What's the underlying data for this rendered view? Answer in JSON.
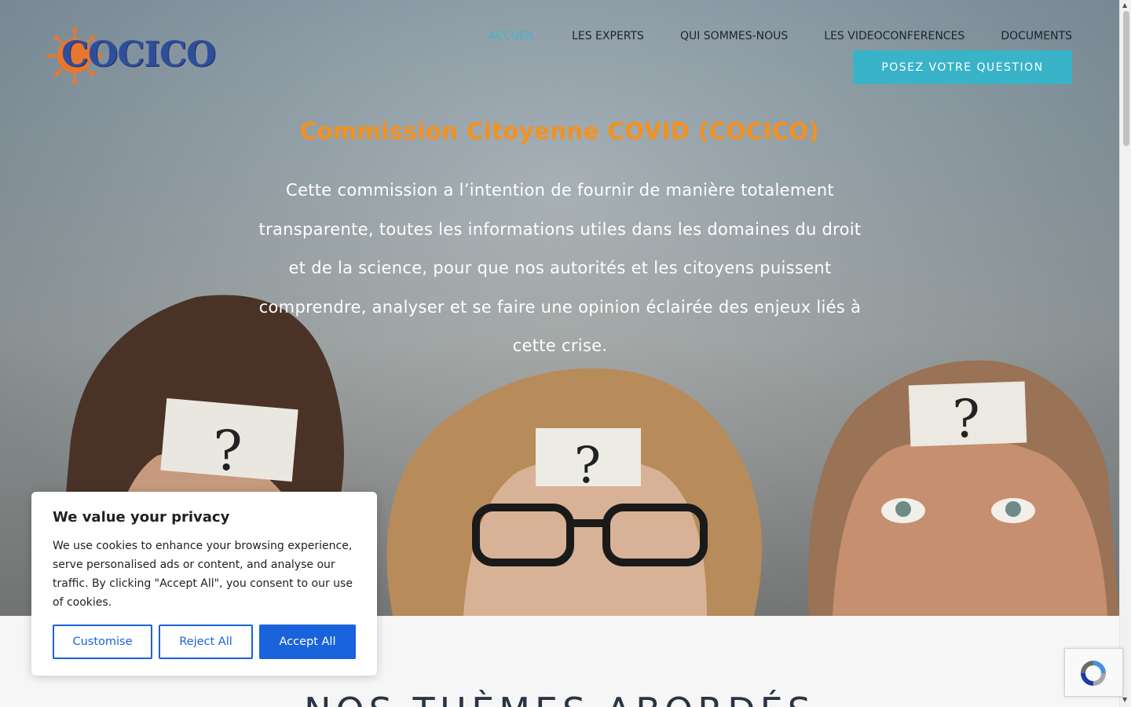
{
  "logo": {
    "text": "COCICO"
  },
  "nav": {
    "items": [
      {
        "label": "ACCUEIL",
        "active": true
      },
      {
        "label": "LES EXPERTS",
        "active": false
      },
      {
        "label": "QUI SOMMES-NOUS",
        "active": false
      },
      {
        "label": "LES VIDEOCONFERENCES",
        "active": false
      },
      {
        "label": "DOCUMENTS",
        "active": false
      }
    ],
    "cta_label": "POSEZ VOTRE QUESTION"
  },
  "hero": {
    "title": "Commission Citoyenne COVID (COCICO)",
    "description": "Cette commission a l’intention de fournir de manière totalement transparente, toutes les informations utiles dans les domaines du droit et de la science, pour que nos autorités et les citoyens puissent comprendre, analyser et se faire une opinion éclairée des enjeux liés à cette crise."
  },
  "section": {
    "title": "NOS THÈMES ABORDÉS"
  },
  "cookie": {
    "title": "We value your privacy",
    "text": "We use cookies to enhance your browsing experience, serve personalised ads or content, and analyse our traffic. By clicking \"Accept All\", you consent to our use of cookies.",
    "customise_label": "Customise",
    "reject_label": "Reject All",
    "accept_label": "Accept All"
  },
  "colors": {
    "accent": "#39b3c8",
    "title_orange": "#f4911e",
    "cookie_blue": "#1863dc"
  },
  "icons": {
    "logo_icon": "virus-icon",
    "recaptcha": "recaptcha-icon"
  }
}
